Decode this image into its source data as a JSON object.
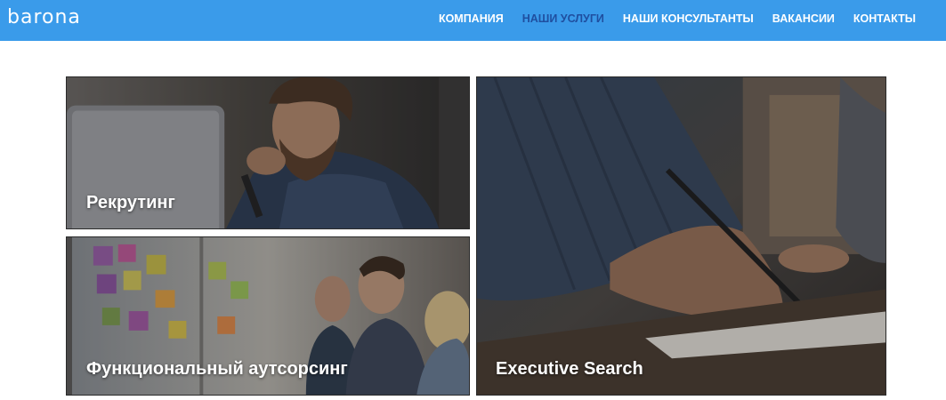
{
  "header": {
    "logo_text": "barona",
    "background_color": "#3a9bea",
    "nav": [
      {
        "label": "КОМПАНИЯ",
        "active": false
      },
      {
        "label": "НАШИ УСЛУГИ",
        "active": true
      },
      {
        "label": "НАШИ КОНСУЛЬТАНТЫ",
        "active": false
      },
      {
        "label": "ВАКАНСИИ",
        "active": false
      },
      {
        "label": "КОНТАКТЫ",
        "active": false
      }
    ],
    "active_nav_color": "#1f4fa0"
  },
  "services": {
    "tiles": [
      {
        "label": "Рекрутинг",
        "image": "man-with-beard-at-laptop-photo"
      },
      {
        "label": "Функциональный аутсорсинг",
        "image": "team-at-sticky-note-wall-photo"
      },
      {
        "label": "Executive Search",
        "image": "hand-writing-with-pen-photo"
      }
    ]
  }
}
